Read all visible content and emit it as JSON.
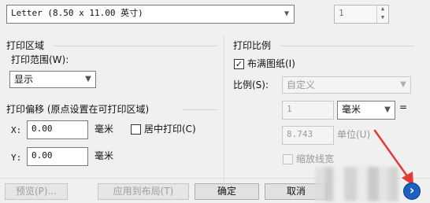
{
  "paper": {
    "size_value": "Letter (8.50 x 11.00 英寸)",
    "copies_value": "1"
  },
  "print_area": {
    "title": "打印区域",
    "range_label": "打印范围(W):",
    "range_value": "显示"
  },
  "print_offset": {
    "title": "打印偏移 (原点设置在可打印区域)",
    "x_label": "X:",
    "x_value": "0.00",
    "x_unit": "毫米",
    "center_label": "居中打印(C)",
    "y_label": "Y:",
    "y_value": "0.00",
    "y_unit": "毫米"
  },
  "print_scale": {
    "title": "打印比例",
    "fit_label": "布满图纸(I)",
    "fit_checked": "✓",
    "scale_label": "比例(S):",
    "scale_value": "自定义",
    "num_value": "1",
    "unit_value": "毫米",
    "equals": "=",
    "den_value": "8.743",
    "units_label": "单位(U)",
    "lineweight_label": "缩放线宽"
  },
  "buttons": {
    "preview": "预览(P)...",
    "apply": "应用到布局(T)",
    "ok": "确定",
    "cancel": "取消"
  },
  "icons": {
    "more_options": "›"
  },
  "colors": {
    "annotation": "#e53935",
    "expand_button": "#1f5fbf"
  }
}
